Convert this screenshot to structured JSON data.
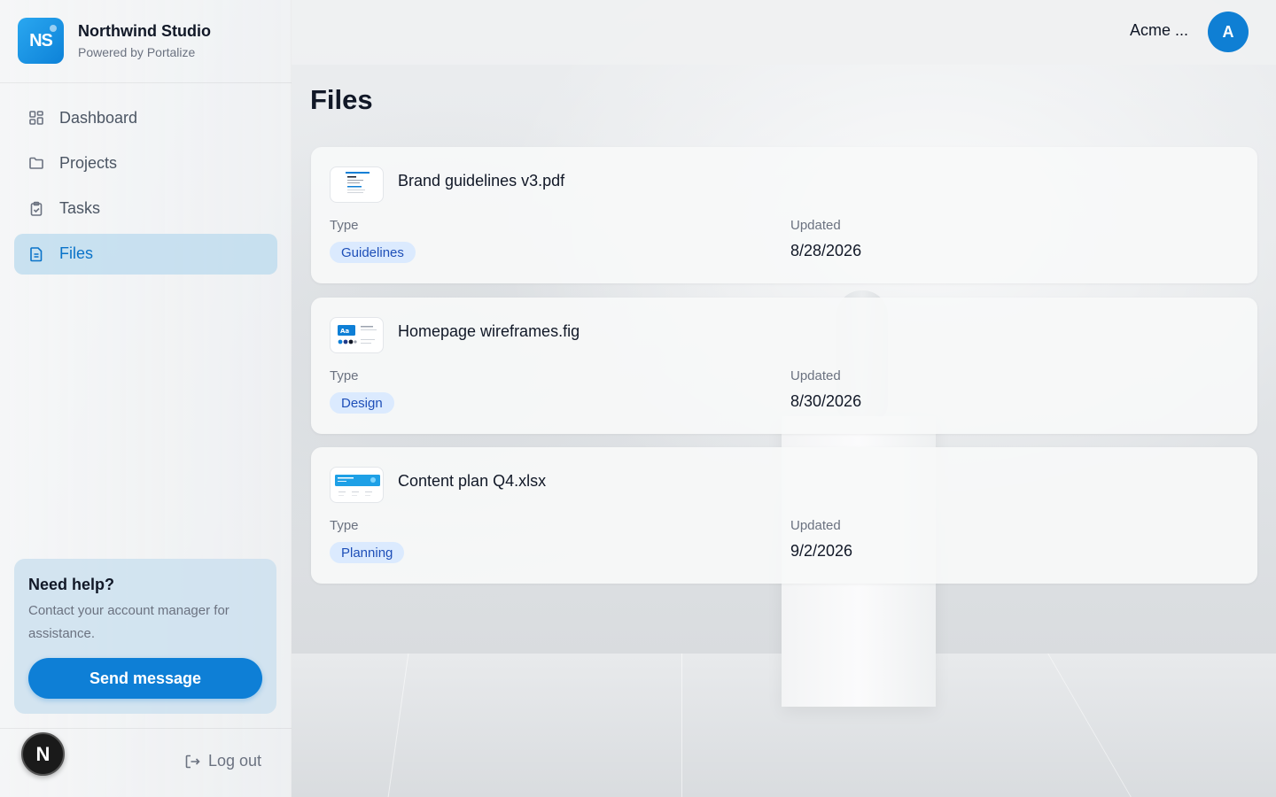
{
  "brand": {
    "initials": "NS",
    "name": "Northwind Studio",
    "subtitle": "Powered by Portalize"
  },
  "nav": {
    "items": [
      {
        "label": "Dashboard",
        "icon": "dashboard-icon"
      },
      {
        "label": "Projects",
        "icon": "folder-icon"
      },
      {
        "label": "Tasks",
        "icon": "clipboard-icon"
      },
      {
        "label": "Files",
        "icon": "file-icon",
        "active": true
      }
    ]
  },
  "help": {
    "title": "Need help?",
    "text": "Contact your account manager for assistance.",
    "button": "Send message"
  },
  "footer": {
    "badge": "N",
    "logout": "Log out"
  },
  "topbar": {
    "org": "Acme ...",
    "avatar": "A"
  },
  "page": {
    "title": "Files"
  },
  "labels": {
    "type": "Type",
    "updated": "Updated"
  },
  "files": [
    {
      "name": "Brand guidelines v3.pdf",
      "type": "Guidelines",
      "updated": "8/28/2026"
    },
    {
      "name": "Homepage wireframes.fig",
      "type": "Design",
      "updated": "8/30/2026"
    },
    {
      "name": "Content plan Q4.xlsx",
      "type": "Planning",
      "updated": "9/2/2026"
    }
  ],
  "colors": {
    "accent": "#0e7fd6",
    "badge_bg": "#dbeafe",
    "badge_text": "#1e4fb8"
  }
}
